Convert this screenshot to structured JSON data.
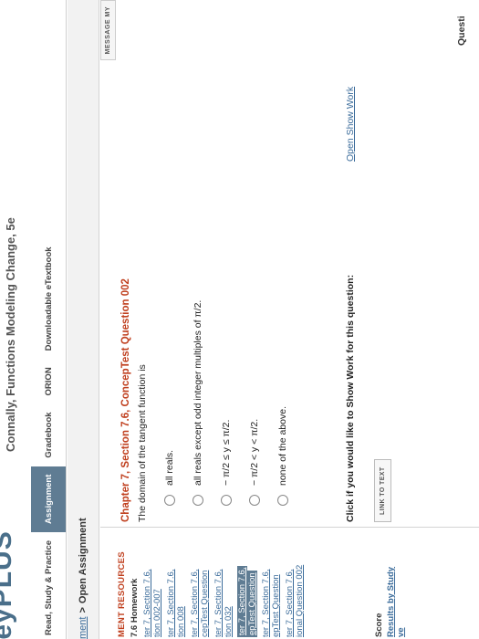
{
  "header": {
    "logo_text": "leyPLUS",
    "book_title": "Connally, Functions Modeling Change, 5e"
  },
  "nav": {
    "items": [
      {
        "label": "Read, Study & Practice"
      },
      {
        "label": "Assignment"
      },
      {
        "label": "Gradebook"
      },
      {
        "label": "ORION"
      },
      {
        "label": "Downloadable eTextbook"
      }
    ]
  },
  "breadcrumb": {
    "link": "ment",
    "separator": ">",
    "current": "Open Assignment"
  },
  "message_button": "MESSAGE MY",
  "sidebar": {
    "heading": "MENT RESOURCES",
    "subheading": "7.6 Homework",
    "links": [
      "ter 7, Section 7.6,",
      "tion 002-007",
      "ter 7, Section 7.6,",
      "tion 008",
      "ter 7, Section 7.6,",
      "cepTest Question",
      "ter 7, Section 7.6,",
      "tion 032",
      "ter 7, Section 7.6,",
      "epTest Question",
      "ter 7, Section 7.6,",
      "epTest Question",
      "ter 7, Section 7.6,",
      "ional Question 002"
    ],
    "score_label": "Score",
    "results_link": "Results by Study",
    "results_link_2": "ve"
  },
  "question": {
    "title": "Chapter 7, Section 7.6, ConcepTest Question 002",
    "text": "The domain of the tangent function is",
    "options": [
      "all reals.",
      "all reals except odd integer multiples of π/2.",
      "− π/2 ≤ y ≤ π/2.",
      "− π/2 < y < π/2.",
      "none of the above."
    ],
    "show_work_prompt": "Click if you would like to Show Work for this question:",
    "show_work_link": "Open Show Work",
    "link_to_text": "LINK TO TEXT"
  },
  "footer_label": "Questi"
}
